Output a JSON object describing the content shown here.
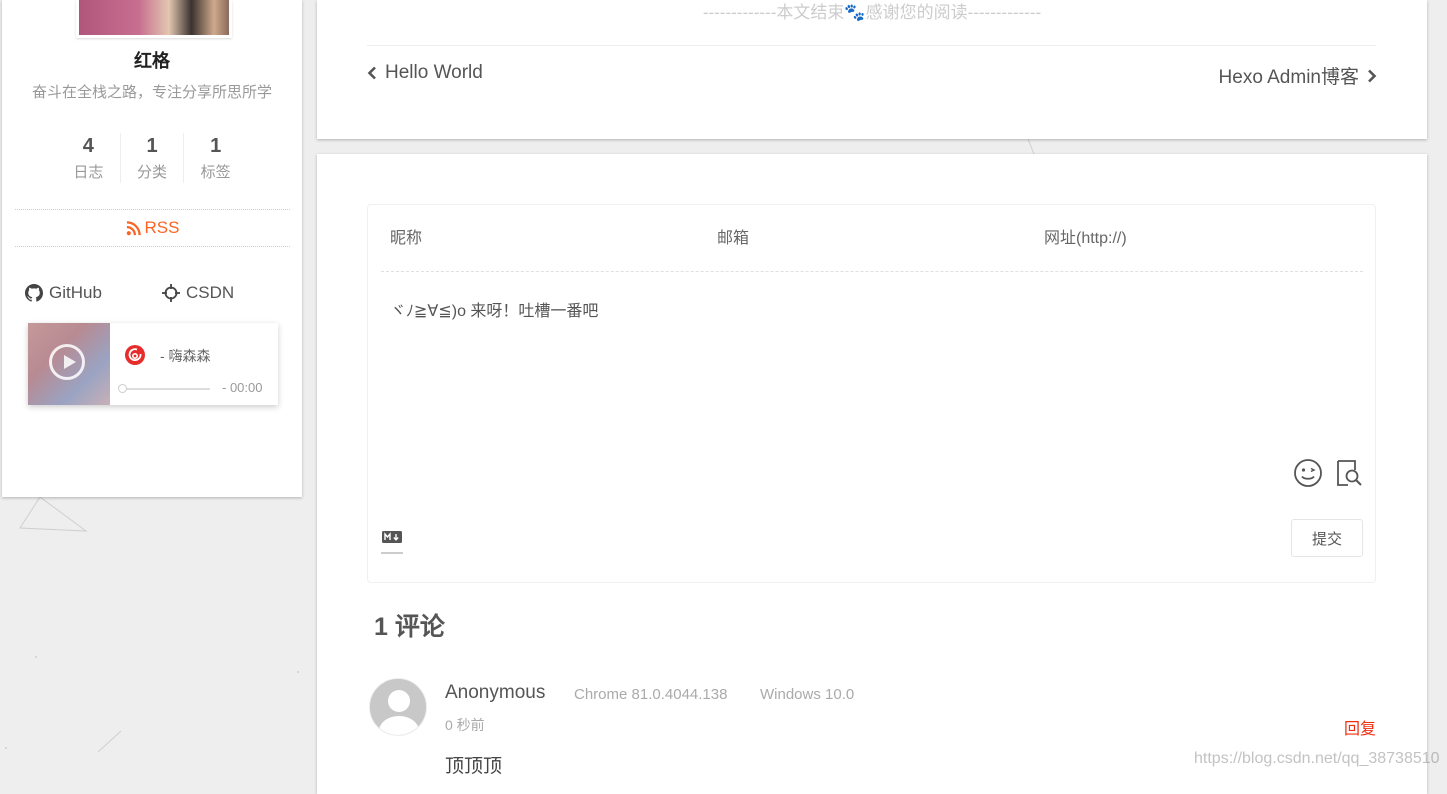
{
  "sidebar": {
    "author_name": "红格",
    "author_desc": "奋斗在全栈之路，专注分享所思所学",
    "stats": [
      {
        "count": "4",
        "label": "日志"
      },
      {
        "count": "1",
        "label": "分类"
      },
      {
        "count": "1",
        "label": "标签"
      }
    ],
    "rss_label": "RSS",
    "links": [
      {
        "label": "GitHub",
        "icon": "github-icon"
      },
      {
        "label": "CSDN",
        "icon": "crosshair-icon"
      }
    ],
    "player": {
      "title": "- 嗨森森",
      "time": "- 00:00",
      "progress": 0,
      "icon": "netease-music-icon"
    }
  },
  "post": {
    "end_text": "-------------本文结束🐾感谢您的阅读-------------",
    "prev_label": "Hello World",
    "next_label": "Hexo Admin博客"
  },
  "comment_form": {
    "nick_placeholder": "昵称",
    "mail_placeholder": "邮箱",
    "link_placeholder": "网址(http://)",
    "content_placeholder": "ヾﾉ≧∀≦)o 来呀！吐槽一番吧",
    "submit_label": "提交"
  },
  "comments": {
    "count_label": "1 评论",
    "items": [
      {
        "nick": "Anonymous",
        "browser": "Chrome 81.0.4044.138",
        "os": "Windows 10.0",
        "time": "0 秒前",
        "reply_label": "回复",
        "content": "顶顶顶"
      }
    ]
  },
  "watermark": "https://blog.csdn.net/qq_38738510",
  "colors": {
    "rss": "#fc6423",
    "reply": "#ef2f11",
    "background": "#eeeeee"
  }
}
